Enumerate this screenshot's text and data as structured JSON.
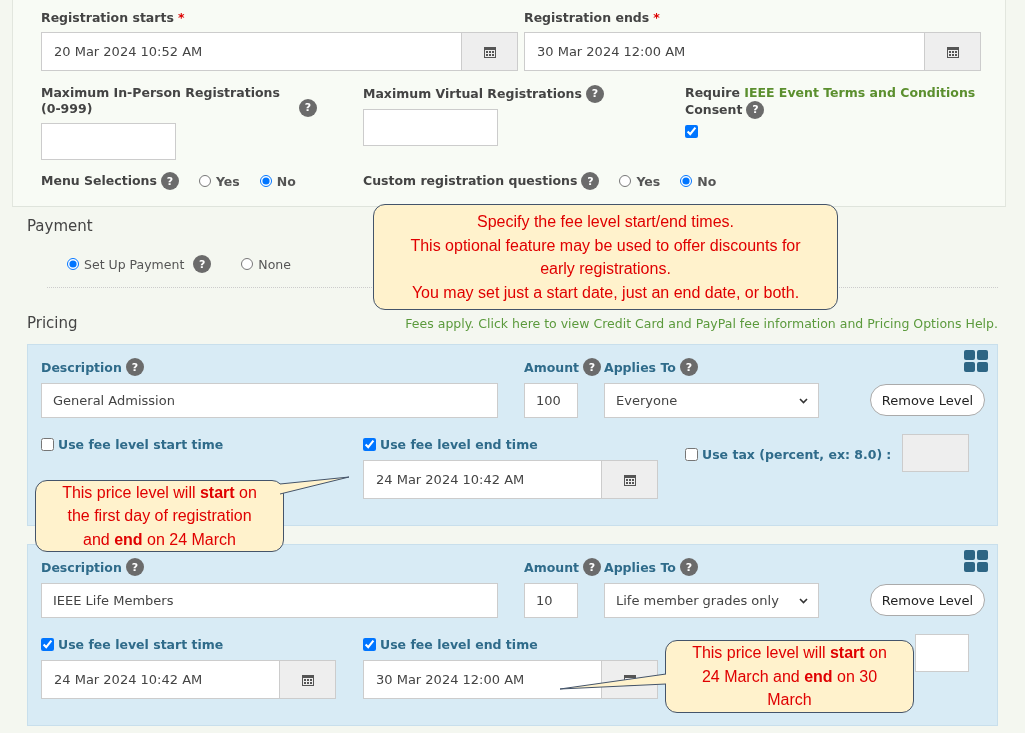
{
  "registration": {
    "starts": {
      "label": "Registration starts",
      "required": "*",
      "value": "20 Mar 2024 10:52 AM"
    },
    "ends": {
      "label": "Registration ends",
      "required": "*",
      "value": "30 Mar 2024 12:00 AM"
    },
    "max_in_person": {
      "label": "Maximum In-Person Registrations (0-999)",
      "help": "?"
    },
    "max_virtual": {
      "label": "Maximum Virtual Registrations",
      "help": "?"
    },
    "terms": {
      "prefix": "Require",
      "link": "IEEE Event Terms and Conditions",
      "suffix": "Consent",
      "help": "?",
      "checked": true
    },
    "menu_selections": {
      "label": "Menu Selections",
      "help": "?",
      "options": [
        {
          "label": "Yes",
          "selected": false
        },
        {
          "label": "No",
          "selected": true
        }
      ]
    },
    "custom_questions": {
      "label": "Custom registration questions",
      "help": "?",
      "options": [
        {
          "label": "Yes",
          "selected": false
        },
        {
          "label": "No",
          "selected": true
        }
      ]
    }
  },
  "payment": {
    "title": "Payment",
    "options": [
      {
        "label": "Set Up Payment",
        "help": "?",
        "selected": true
      },
      {
        "label": "None",
        "selected": false
      }
    ]
  },
  "pricing": {
    "title": "Pricing",
    "fees_link": "Fees apply. Click here to view Credit Card and PayPal fee information and Pricing Options Help."
  },
  "levels": [
    {
      "description_label": "Description",
      "description_help": "?",
      "description": "General Admission",
      "amount_label": "Amount",
      "amount_help": "?",
      "amount": "100",
      "applies_label": "Applies To",
      "applies_help": "?",
      "applies_to": "Everyone",
      "remove_button": "Remove Level",
      "start": {
        "label": "Use fee level start time",
        "checked": false
      },
      "end": {
        "label": "Use fee level end time",
        "checked": true,
        "value": "24 Mar 2024 10:42 AM"
      },
      "tax": {
        "label": "Use tax (percent, ex: 8.0)",
        "separator": ":",
        "checked": false,
        "disabled": true
      }
    },
    {
      "description_label": "Description",
      "description_help": "?",
      "description": "IEEE Life Members",
      "amount_label": "Amount",
      "amount_help": "?",
      "amount": "10",
      "applies_label": "Applies To",
      "applies_help": "?",
      "applies_to": "Life member grades only",
      "remove_button": "Remove Level",
      "start": {
        "label": "Use fee level start time",
        "checked": true,
        "value": "24 Mar 2024 10:42 AM"
      },
      "end": {
        "label": "Use fee level end time",
        "checked": true,
        "value": "30 Mar 2024 12:00 AM"
      },
      "tax": {
        "disabled": false
      }
    }
  ],
  "callouts": [
    {
      "lines": [
        "Specify the fee level start/end times.",
        "This optional feature may be used to offer discounts for",
        "early registrations.",
        "You may set just a start date, just an end date, or both."
      ]
    },
    {
      "lines": [
        "This price level will **start** on",
        "the first day of registration",
        "and **end** on 24 March"
      ]
    },
    {
      "lines": [
        "This price level will **start** on",
        "24 March and **end** on 30",
        "March"
      ]
    }
  ]
}
